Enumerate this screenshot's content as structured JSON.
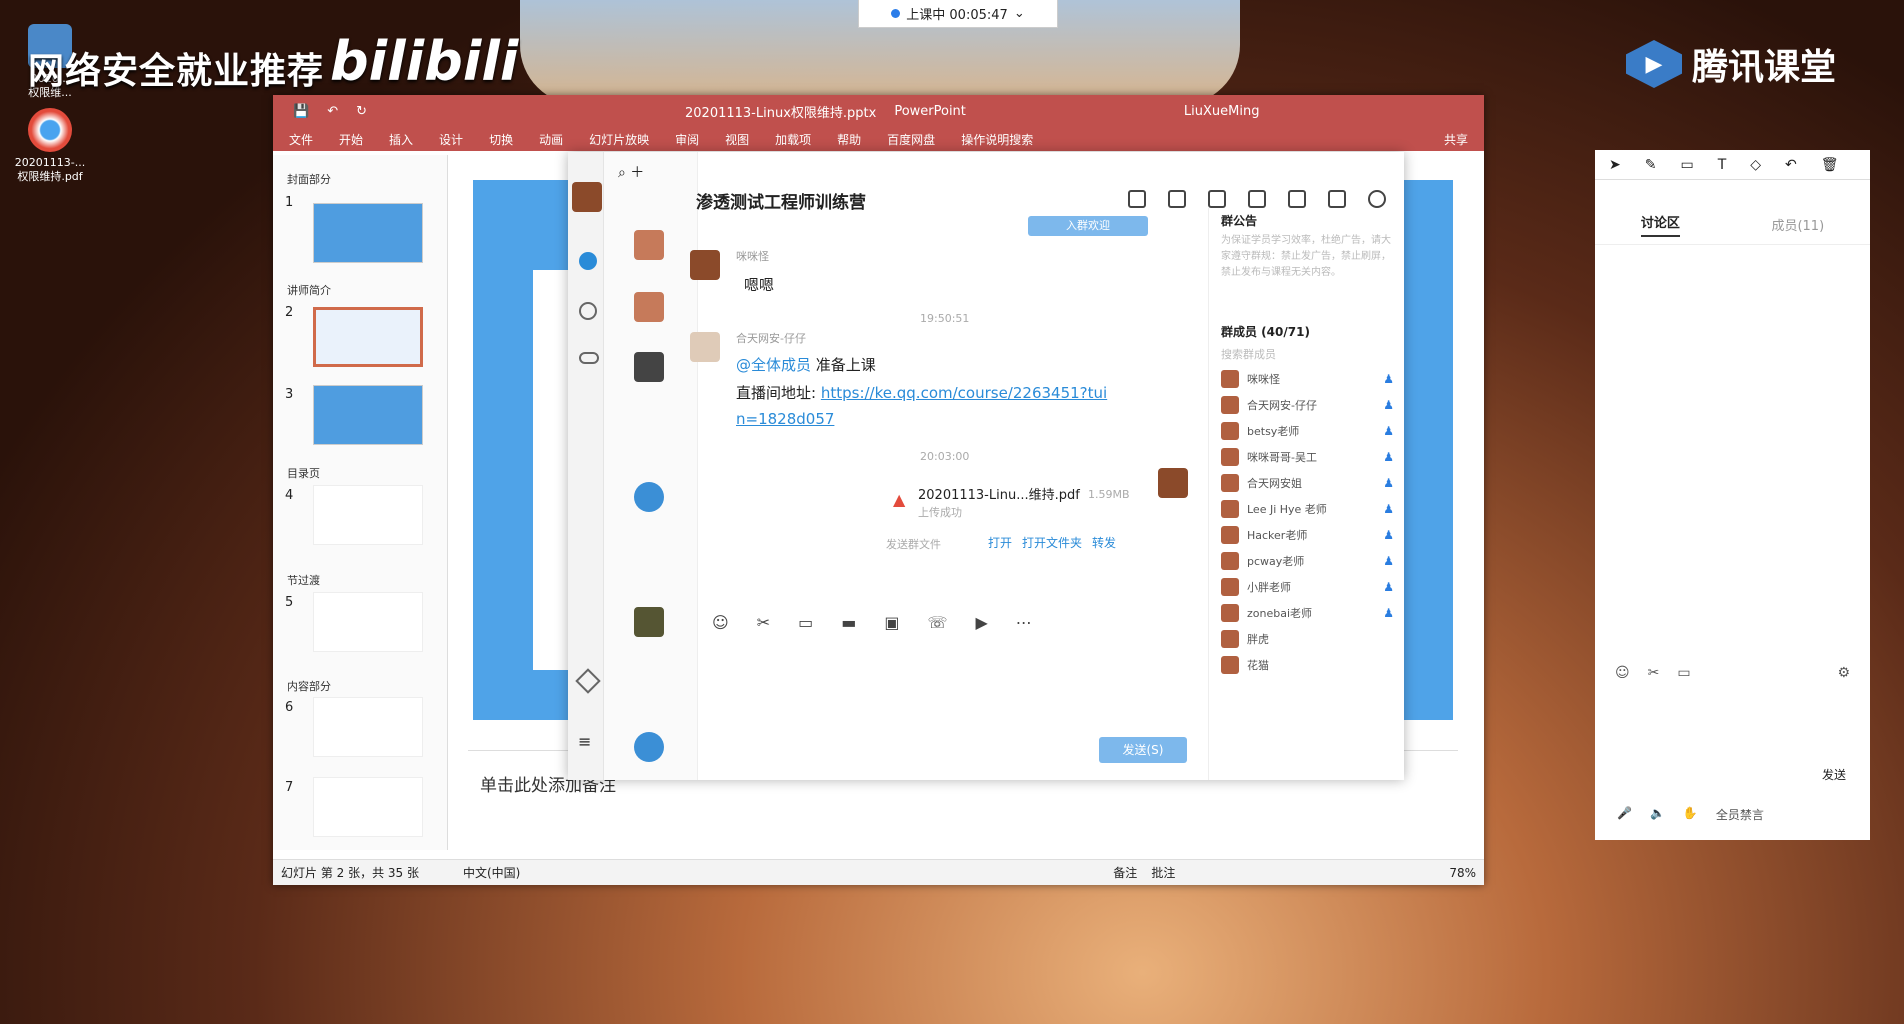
{
  "timer": {
    "text": "上课中 00:05:47",
    "arrow": "⌄"
  },
  "desktop": {
    "icon1_label": "2020...\n权限维...",
    "icon2_label": "20201113-...\n权限维持.pdf",
    "watermark": "网络安全就业推荐",
    "bili": "bilibili",
    "tencent": "腾讯课堂"
  },
  "ppt": {
    "title_filename": "20201113-Linux权限维持.pptx",
    "title_app": "PowerPoint",
    "user": "LiuXueMing",
    "menu": [
      "文件",
      "开始",
      "插入",
      "设计",
      "切换",
      "动画",
      "幻灯片放映",
      "审阅",
      "视图",
      "加载项",
      "帮助",
      "百度网盘",
      "操作说明搜索"
    ],
    "share": "共享",
    "sections": [
      "封面部分",
      "讲师简介",
      "目录页",
      "节过渡",
      "内容部分"
    ],
    "slide_numbers": [
      "1",
      "2",
      "3",
      "4",
      "5",
      "6",
      "7"
    ],
    "notes_placeholder": "单击此处添加备注",
    "status_slide": "幻灯片 第 2 张，共 35 张",
    "status_lang": "中文(中国)",
    "status_notes": "备注",
    "status_comments": "批注",
    "zoom": "78%"
  },
  "qq": {
    "chat_title": "渗透测试工程师训练营",
    "btn_top": "入群欢迎",
    "msg1_nick": "咪咪怪",
    "msg1_text": "嗯嗯",
    "time1": "19:50:51",
    "msg2_nick": "合天网安-仔仔",
    "msg2_mention": "@全体成员",
    "msg2_text": "准备上课",
    "msg2_line2_label": "直播间地址:",
    "msg2_link": "https://ke.qq.com/course/2263451?tuin=1828d057",
    "time2": "20:03:00",
    "file_name": "20201113-Linu...维持.pdf",
    "file_size": "1.59MB",
    "file_status": "上传成功",
    "file_hint": "发送群文件",
    "file_actions": [
      "打开",
      "打开文件夹",
      "转发"
    ],
    "send": "发送(S)",
    "notice_title": "群公告",
    "notice_text": "为保证学员学习效率，杜绝广告，请大家遵守群规：禁止发广告，禁止刷屏，禁止发布与课程无关内容。",
    "members_title": "群成员 (40/71)",
    "members_search": "搜索群成员",
    "members": [
      "咪咪怪",
      "合天网安-仔仔",
      "betsy老师",
      "咪咪哥哥-吴工",
      "合天网安姐",
      "Lee Ji Hye 老师",
      "Hacker老师",
      "pcway老师",
      "小胖老师",
      "zonebai老师",
      "胖虎",
      "花猫"
    ]
  },
  "classroom": {
    "tab_discuss": "讨论区",
    "tab_members": "成员(11)",
    "send": "发送",
    "bottom_hint": "全员禁言"
  }
}
